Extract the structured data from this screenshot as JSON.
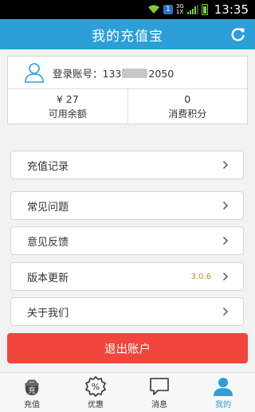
{
  "status_bar": {
    "badge": "1",
    "network_top": "3G",
    "network_bottom": "1X",
    "time": "13:35"
  },
  "header": {
    "title": "我的充值宝",
    "refresh_icon": "refresh-icon"
  },
  "account": {
    "label": "登录账号：",
    "number_prefix": "133",
    "number_suffix": "2050",
    "balance_value": "¥ 27",
    "balance_label": "可用余额",
    "points_value": "0",
    "points_label": "消费积分"
  },
  "menu": {
    "items": [
      {
        "label": "充值记录",
        "extra": ""
      },
      {
        "label": "常见问题",
        "extra": ""
      },
      {
        "label": "意见反馈",
        "extra": ""
      },
      {
        "label": "版本更新",
        "extra": "3.0.6"
      },
      {
        "label": "关于我们",
        "extra": ""
      }
    ]
  },
  "logout": {
    "label": "退出账户"
  },
  "bottom_nav": {
    "items": [
      {
        "label": "充值",
        "icon": "recharge-bag-icon"
      },
      {
        "label": "优惠",
        "icon": "discount-icon"
      },
      {
        "label": "消息",
        "icon": "message-icon"
      },
      {
        "label": "我的",
        "icon": "user-icon"
      }
    ],
    "active": "我的"
  },
  "colors": {
    "accent": "#2c9fd8",
    "logout": "#f2453b",
    "version": "#c58b3a"
  }
}
